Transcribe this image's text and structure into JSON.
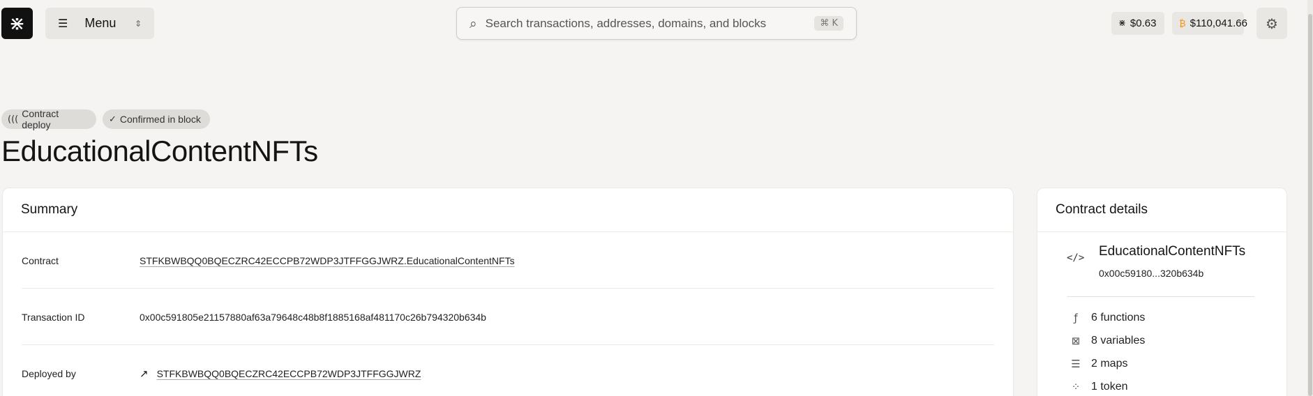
{
  "header": {
    "logo_glyph": "⋇",
    "menu_label": "Menu",
    "search_placeholder": "Search transactions, addresses, domains, and blocks",
    "search_shortcut": "⌘ K",
    "stx_price": "$0.63",
    "btc_price": "$110,041.66"
  },
  "badges": {
    "deploy": "Contract deploy",
    "confirmed": "Confirmed in block"
  },
  "page_title": "EducationalContentNFTs",
  "summary": {
    "title": "Summary",
    "rows": [
      {
        "label": "Contract",
        "value": "STFKBWBQQ0BQECZRC42ECCPB72WDP3JTFFGGJWRZ.EducationalContentNFTs"
      },
      {
        "label": "Transaction ID",
        "value": "0x00c591805e21157880af63a79648c48b8f1885168af481170c26b794320b634b"
      },
      {
        "label": "Deployed by",
        "value": "STFKBWBQQ0BQECZRC42ECCPB72WDP3JTFFGGJWRZ"
      }
    ]
  },
  "contract_details": {
    "title": "Contract details",
    "name": "EducationalContentNFTs",
    "address": "0x00c59180...320b634b",
    "stats": [
      {
        "label": "6 functions",
        "icon": "function-icon"
      },
      {
        "label": "8 variables",
        "icon": "variable-icon"
      },
      {
        "label": "2 maps",
        "icon": "map-list-icon"
      },
      {
        "label": "1 token",
        "icon": "token-icon"
      }
    ]
  },
  "colors": {
    "background": "#f5f4f2",
    "card": "#ffffff",
    "logo": "#111111",
    "btc": "#f7931a"
  }
}
